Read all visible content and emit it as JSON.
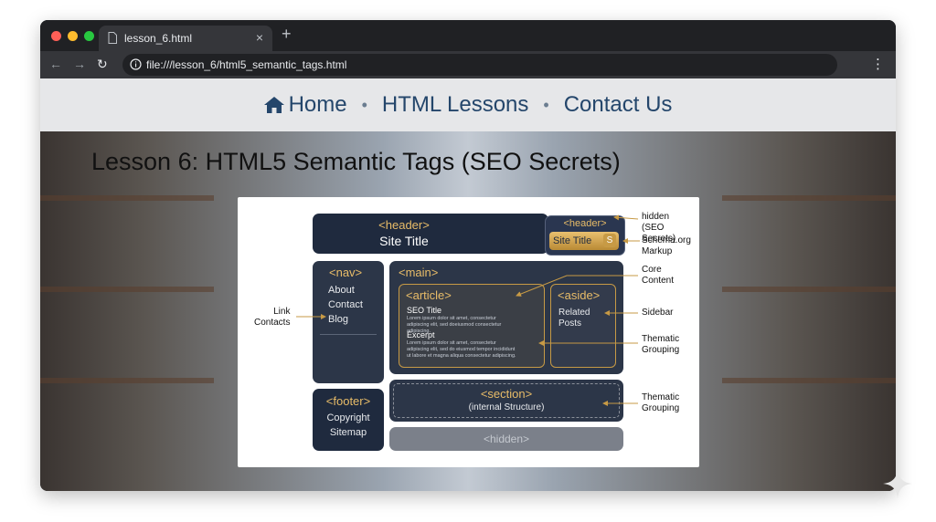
{
  "browser": {
    "tab_title": "lesson_6.html",
    "tab_close": "×",
    "new_tab": "+",
    "url": "file:///lesson_6/html5_semantic_tags.html"
  },
  "site_nav": {
    "items": [
      {
        "label": "Home"
      },
      {
        "label": "HTML Lessons"
      },
      {
        "label": "Contact Us"
      }
    ],
    "separator": "•"
  },
  "page": {
    "lesson_title": "Lesson 6: HTML5 Semantic Tags (SEO Secrets)"
  },
  "diagram": {
    "header": {
      "tag": "<header>",
      "title": "Site Title"
    },
    "header_badge": {
      "tag": "<header>",
      "title": "Site Title",
      "icon_letter": "S"
    },
    "nav": {
      "tag": "<nav>",
      "links": [
        "About",
        "Contact",
        "Blog"
      ]
    },
    "main": {
      "tag": "<main>"
    },
    "article": {
      "tag": "<article>",
      "seo_title": "SEO Title",
      "lorem1": "Lorem ipsum dolor sit amet, consectetur adipiscing elit, sed doeiusmod consectetur adipiscing.",
      "excerpt": "Excerpt",
      "lorem2": "Lorem ipsum dolor sit amet, consectetur adipiscing elit, sed do eiusmod tempor incididunt ut labore et magna aliqua consectetur adipiscing."
    },
    "aside": {
      "tag": "<aside>",
      "line1": "Related",
      "line2": "Posts"
    },
    "footer": {
      "tag": "<footer>",
      "line1": "Copyright",
      "line2": "Sitemap"
    },
    "section": {
      "tag": "<section>",
      "subtitle": "(internal Structure)"
    },
    "hidden": {
      "tag": "<hidden>"
    },
    "annotations": {
      "hidden_l1": "hidden",
      "hidden_l2": "(SEO Secrets)",
      "schema_l1": "Schema.org",
      "schema_l2": "Markup",
      "core_l1": "Core",
      "core_l2": "Content",
      "sidebar": "Sidebar",
      "thematic1_l1": "Thematic",
      "thematic1_l2": "Grouping",
      "thematic2_l1": "Thematic",
      "thematic2_l2": "Grouping",
      "link_l1": "Link",
      "link_l2": "Contacts"
    }
  },
  "colors": {
    "nav_text": "#24466b",
    "box_dark": "#1f2a3e",
    "accent_gold": "#e8bc68"
  }
}
